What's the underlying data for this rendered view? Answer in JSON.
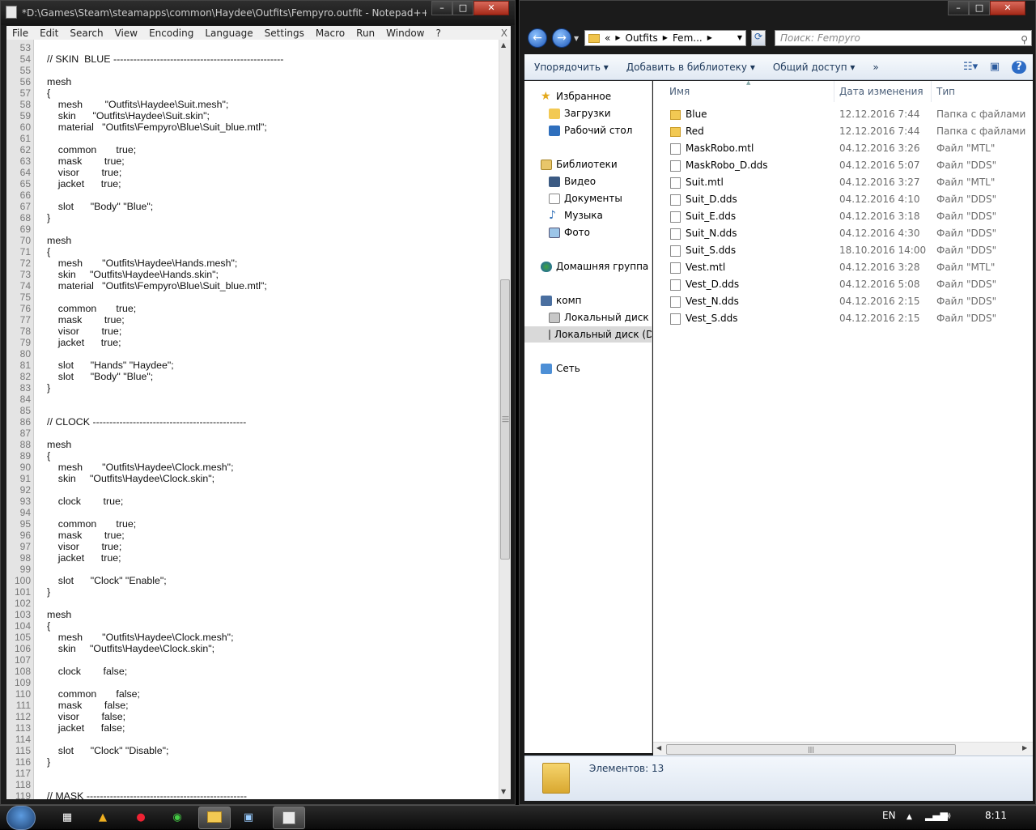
{
  "notepad": {
    "title": "*D:\\Games\\Steam\\steamapps\\common\\Haydee\\Outfits\\Fempyro.outfit - Notepad++ [Admi...",
    "menu": [
      "File",
      "Edit",
      "Search",
      "View",
      "Encoding",
      "Language",
      "Settings",
      "Macro",
      "Run",
      "Window",
      "?"
    ],
    "close_x": "X",
    "lines": [
      {
        "n": "53",
        "t": ""
      },
      {
        "n": "54",
        "t": "// SKIN  BLUE ---------------------------------------------------"
      },
      {
        "n": "55",
        "t": ""
      },
      {
        "n": "56",
        "t": "mesh"
      },
      {
        "n": "57",
        "t": "{"
      },
      {
        "n": "58",
        "t": "    mesh        \"Outfits\\Haydee\\Suit.mesh\";"
      },
      {
        "n": "59",
        "t": "    skin      \"Outfits\\Haydee\\Suit.skin\";"
      },
      {
        "n": "60",
        "t": "    material   \"Outfits\\Fempyro\\Blue\\Suit_blue.mtl\";"
      },
      {
        "n": "61",
        "t": ""
      },
      {
        "n": "62",
        "t": "    common       true;"
      },
      {
        "n": "63",
        "t": "    mask        true;"
      },
      {
        "n": "64",
        "t": "    visor        true;"
      },
      {
        "n": "65",
        "t": "    jacket      true;"
      },
      {
        "n": "66",
        "t": ""
      },
      {
        "n": "67",
        "t": "    slot      \"Body\" \"Blue\";"
      },
      {
        "n": "68",
        "t": "}"
      },
      {
        "n": "69",
        "t": ""
      },
      {
        "n": "70",
        "t": "mesh"
      },
      {
        "n": "71",
        "t": "{"
      },
      {
        "n": "72",
        "t": "    mesh       \"Outfits\\Haydee\\Hands.mesh\";"
      },
      {
        "n": "73",
        "t": "    skin     \"Outfits\\Haydee\\Hands.skin\";"
      },
      {
        "n": "74",
        "t": "    material   \"Outfits\\Fempyro\\Blue\\Suit_blue.mtl\";"
      },
      {
        "n": "75",
        "t": ""
      },
      {
        "n": "76",
        "t": "    common       true;"
      },
      {
        "n": "77",
        "t": "    mask        true;"
      },
      {
        "n": "78",
        "t": "    visor        true;"
      },
      {
        "n": "79",
        "t": "    jacket      true;"
      },
      {
        "n": "80",
        "t": ""
      },
      {
        "n": "81",
        "t": "    slot      \"Hands\" \"Haydee\";"
      },
      {
        "n": "82",
        "t": "    slot      \"Body\" \"Blue\";"
      },
      {
        "n": "83",
        "t": "}"
      },
      {
        "n": "84",
        "t": ""
      },
      {
        "n": "85",
        "t": ""
      },
      {
        "n": "86",
        "t": "// CLOCK ----------------------------------------------"
      },
      {
        "n": "87",
        "t": ""
      },
      {
        "n": "88",
        "t": "mesh"
      },
      {
        "n": "89",
        "t": "{"
      },
      {
        "n": "90",
        "t": "    mesh       \"Outfits\\Haydee\\Clock.mesh\";"
      },
      {
        "n": "91",
        "t": "    skin     \"Outfits\\Haydee\\Clock.skin\";"
      },
      {
        "n": "92",
        "t": ""
      },
      {
        "n": "93",
        "t": "    clock        true;"
      },
      {
        "n": "94",
        "t": ""
      },
      {
        "n": "95",
        "t": "    common       true;"
      },
      {
        "n": "96",
        "t": "    mask        true;"
      },
      {
        "n": "97",
        "t": "    visor        true;"
      },
      {
        "n": "98",
        "t": "    jacket      true;"
      },
      {
        "n": "99",
        "t": ""
      },
      {
        "n": "100",
        "t": "    slot      \"Clock\" \"Enable\";"
      },
      {
        "n": "101",
        "t": "}"
      },
      {
        "n": "102",
        "t": ""
      },
      {
        "n": "103",
        "t": "mesh"
      },
      {
        "n": "104",
        "t": "{"
      },
      {
        "n": "105",
        "t": "    mesh       \"Outfits\\Haydee\\Clock.mesh\";"
      },
      {
        "n": "106",
        "t": "    skin     \"Outfits\\Haydee\\Clock.skin\";"
      },
      {
        "n": "107",
        "t": ""
      },
      {
        "n": "108",
        "t": "    clock        false;"
      },
      {
        "n": "109",
        "t": ""
      },
      {
        "n": "110",
        "t": "    common       false;"
      },
      {
        "n": "111",
        "t": "    mask        false;"
      },
      {
        "n": "112",
        "t": "    visor        false;"
      },
      {
        "n": "113",
        "t": "    jacket      false;"
      },
      {
        "n": "114",
        "t": ""
      },
      {
        "n": "115",
        "t": "    slot      \"Clock\" \"Disable\";"
      },
      {
        "n": "116",
        "t": "}"
      },
      {
        "n": "117",
        "t": ""
      },
      {
        "n": "118",
        "t": ""
      },
      {
        "n": "119",
        "t": "// MASK ------------------------------------------------"
      }
    ]
  },
  "explorer": {
    "breadcrumb": [
      "«",
      "Outfits",
      "Fem..."
    ],
    "search_placeholder": "Поиск: Fempyro",
    "toolbar": [
      "Упорядочить ▾",
      "Добавить в библиотеку ▾",
      "Общий доступ ▾",
      "»"
    ],
    "nav": {
      "favorites": "Избранное",
      "downloads": "Загрузки",
      "desktop": "Рабочий стол",
      "libraries": "Библиотеки",
      "video": "Видео",
      "documents": "Документы",
      "music": "Музыка",
      "photo": "Фото",
      "homegroup": "Домашняя группа",
      "computer": "комп",
      "disk_c": "Локальный диск (C:",
      "disk_d": "Локальный диск (D:",
      "network": "Сеть"
    },
    "columns": {
      "name": "Имя",
      "date": "Дата изменения",
      "type": "Тип"
    },
    "files": [
      {
        "name": "Blue",
        "date": "12.12.2016 7:44",
        "type": "Папка с файлами",
        "kind": "folder"
      },
      {
        "name": "Red",
        "date": "12.12.2016 7:44",
        "type": "Папка с файлами",
        "kind": "folder"
      },
      {
        "name": "MaskRobo.mtl",
        "date": "04.12.2016 3:26",
        "type": "Файл \"MTL\"",
        "kind": "file"
      },
      {
        "name": "MaskRobo_D.dds",
        "date": "04.12.2016 5:07",
        "type": "Файл \"DDS\"",
        "kind": "file"
      },
      {
        "name": "Suit.mtl",
        "date": "04.12.2016 3:27",
        "type": "Файл \"MTL\"",
        "kind": "file"
      },
      {
        "name": "Suit_D.dds",
        "date": "04.12.2016 4:10",
        "type": "Файл \"DDS\"",
        "kind": "file"
      },
      {
        "name": "Suit_E.dds",
        "date": "04.12.2016 3:18",
        "type": "Файл \"DDS\"",
        "kind": "file"
      },
      {
        "name": "Suit_N.dds",
        "date": "04.12.2016 4:30",
        "type": "Файл \"DDS\"",
        "kind": "file"
      },
      {
        "name": "Suit_S.dds",
        "date": "18.10.2016 14:00",
        "type": "Файл \"DDS\"",
        "kind": "file"
      },
      {
        "name": "Vest.mtl",
        "date": "04.12.2016 3:28",
        "type": "Файл \"MTL\"",
        "kind": "file"
      },
      {
        "name": "Vest_D.dds",
        "date": "04.12.2016 5:08",
        "type": "Файл \"DDS\"",
        "kind": "file"
      },
      {
        "name": "Vest_N.dds",
        "date": "04.12.2016 2:15",
        "type": "Файл \"DDS\"",
        "kind": "file"
      },
      {
        "name": "Vest_S.dds",
        "date": "04.12.2016 2:15",
        "type": "Файл \"DDS\"",
        "kind": "file"
      }
    ],
    "status": "Элементов: 13"
  },
  "taskbar": {
    "lang": "EN",
    "clock": "8:11"
  },
  "colors": {
    "accent": "#2d6cc6",
    "folder": "#f2c953"
  }
}
